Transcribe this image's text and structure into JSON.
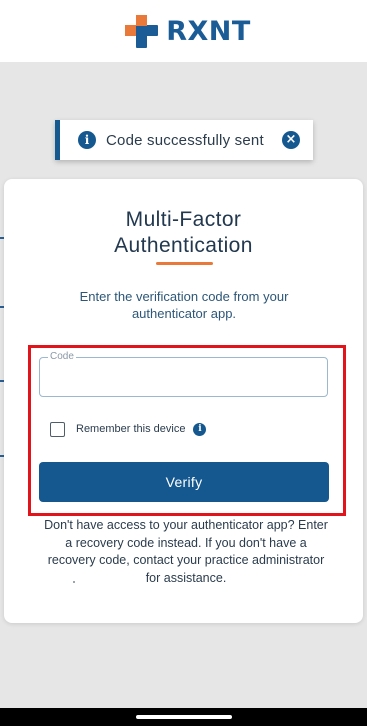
{
  "header": {
    "brand_name": "RXNT",
    "logo_colors": {
      "orange": "#e9793a",
      "blue": "#1c5c96"
    }
  },
  "toast": {
    "icon": "info-icon",
    "message": "Code successfully sent",
    "close_icon": "close-icon"
  },
  "card": {
    "title_line1": "Multi-Factor",
    "title_line2": "Authentication",
    "instructions": "Enter the verification code from your authenticator app.",
    "code_field": {
      "label": "Code",
      "value": ""
    },
    "remember": {
      "label": "Remember this device",
      "checked": false,
      "icon": "info-icon"
    },
    "verify_label": "Verify",
    "help_text": "Don't have access to your authenticator app? Enter a recovery code instead. If you don't have a recovery code, contact your practice administrator for assistance."
  },
  "colors": {
    "primary": "#14588f",
    "accent": "#e9793a",
    "highlight": "#e1141b",
    "background": "#e6e6e6"
  }
}
